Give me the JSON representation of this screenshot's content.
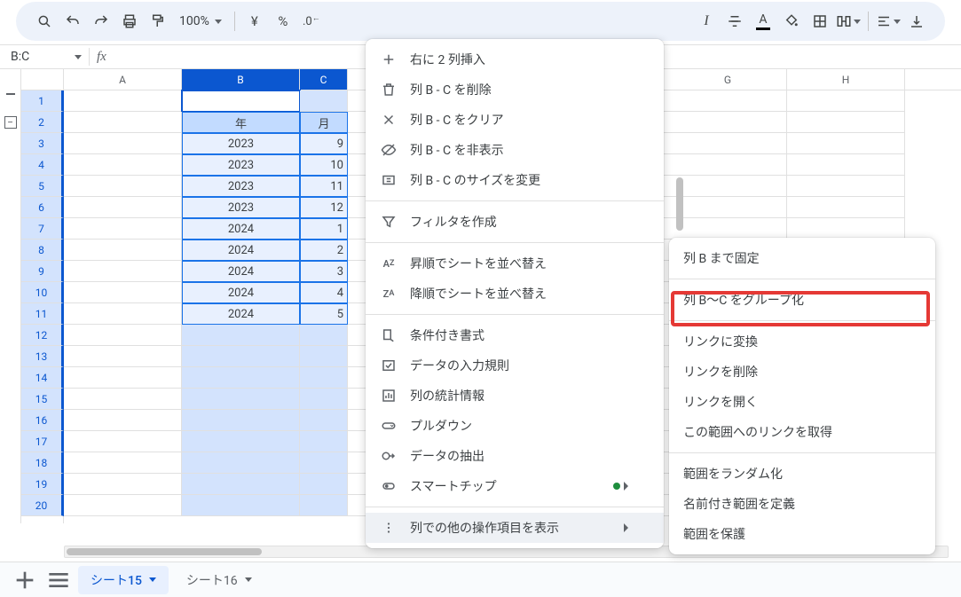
{
  "toolbar": {
    "zoom": "100%",
    "currency": "¥",
    "percent": "%"
  },
  "namebox": "B:C",
  "fx_label": "fx",
  "columns": {
    "A": "A",
    "B": "B",
    "C": "C",
    "G": "G",
    "H": "H"
  },
  "rownums": [
    "1",
    "2",
    "3",
    "4",
    "5",
    "6",
    "7",
    "8",
    "9",
    "10",
    "11",
    "12",
    "13",
    "14",
    "15",
    "16",
    "17",
    "18",
    "19",
    "20"
  ],
  "data": {
    "header": {
      "B": "年",
      "C": "月"
    },
    "rows": [
      {
        "B": "2023",
        "C": "9"
      },
      {
        "B": "2023",
        "C": "10"
      },
      {
        "B": "2023",
        "C": "11"
      },
      {
        "B": "2023",
        "C": "12"
      },
      {
        "B": "2024",
        "C": "1"
      },
      {
        "B": "2024",
        "C": "2"
      },
      {
        "B": "2024",
        "C": "3"
      },
      {
        "B": "2024",
        "C": "4"
      },
      {
        "B": "2024",
        "C": "5"
      }
    ]
  },
  "sheets": {
    "active": "シート15",
    "other": "シート16"
  },
  "menu1": {
    "insert": "右に 2 列挿入",
    "delete": "列 B - C を削除",
    "clear": "列 B - C をクリア",
    "hide": "列 B - C を非表示",
    "resize": "列 B - C のサイズを変更",
    "filter": "フィルタを作成",
    "sort_asc": "昇順でシートを並べ替え",
    "sort_desc": "降順でシートを並べ替え",
    "cond_format": "条件付き書式",
    "validation": "データの入力規則",
    "stats": "列の統計情報",
    "dropdown_chip": "プルダウン",
    "extract": "データの抽出",
    "smartchip": "スマートチップ",
    "more": "列での他の操作項目を表示"
  },
  "menu2": {
    "freeze": "列 B まで固定",
    "group": "列 B～C をグループ化",
    "link_convert": "リンクに変換",
    "link_remove": "リンクを削除",
    "link_open": "リンクを開く",
    "link_get": "この範囲へのリンクを取得",
    "randomize": "範囲をランダム化",
    "named_range": "名前付き範囲を定義",
    "protect": "範囲を保護"
  }
}
